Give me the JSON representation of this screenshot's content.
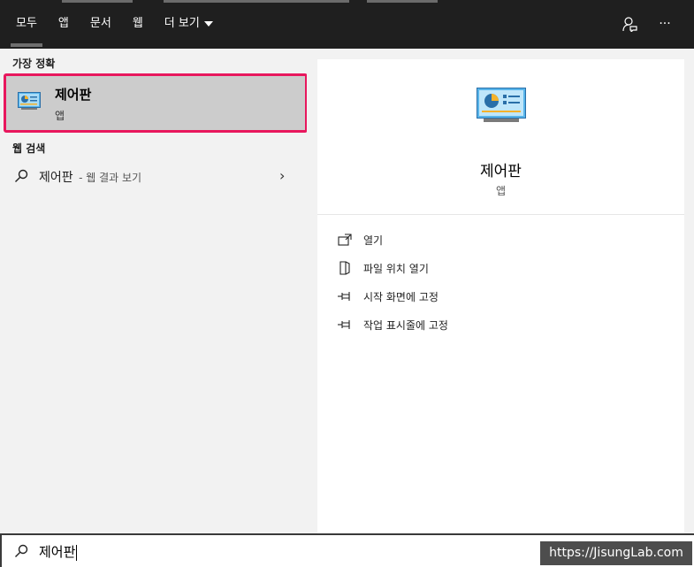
{
  "header": {
    "tabs": [
      {
        "label": "모두",
        "active": true
      },
      {
        "label": "앱"
      },
      {
        "label": "문서"
      },
      {
        "label": "웹"
      },
      {
        "label": "더 보기"
      }
    ],
    "icons": [
      "feedback-icon",
      "more-icon"
    ],
    "more_label": "···"
  },
  "results": {
    "best_match_title": "가장 정확",
    "best_match": {
      "name": "제어판",
      "type": "앱",
      "icon": "control-panel-icon"
    },
    "web_title": "웹 검색",
    "web_query": "제어판",
    "web_suffix": "- 웹 결과 보기"
  },
  "detail": {
    "name": "제어판",
    "type": "앱",
    "actions": [
      {
        "label": "열기",
        "icon": "open-icon"
      },
      {
        "label": "파일 위치 열기",
        "icon": "file-location-icon"
      },
      {
        "label": "시작 화면에 고정",
        "icon": "pin-icon"
      },
      {
        "label": "작업 표시줄에 고정",
        "icon": "pin-icon"
      }
    ]
  },
  "search": {
    "value": "제어판"
  },
  "watermark": "https://JisungLab.com",
  "colors": {
    "highlight_border": "#e8175d",
    "topbar": "#1f1f1f",
    "selected_bg": "#cccccc"
  }
}
